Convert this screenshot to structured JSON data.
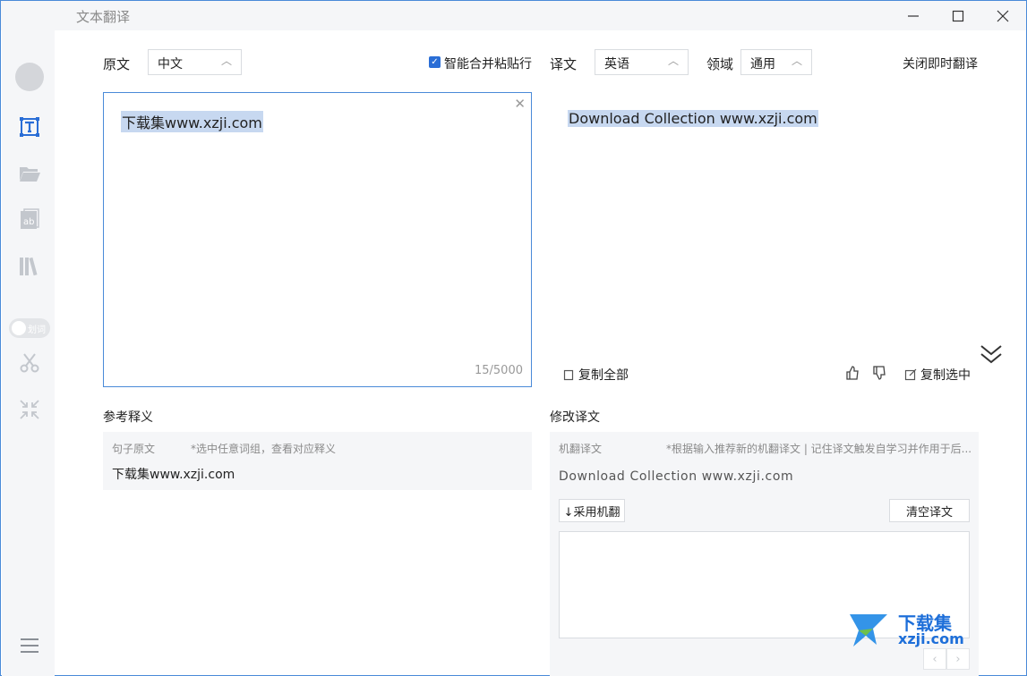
{
  "window": {
    "title": "文本翻译"
  },
  "source": {
    "label": "原文",
    "language": "中文",
    "smart_merge_label": "智能合并粘贴行",
    "text": "下载集www.xzji.com",
    "counter": "15/5000"
  },
  "target": {
    "label": "译文",
    "language": "英语",
    "domain_label": "领域",
    "domain": "通用",
    "close_instant": "关闭即时翻译",
    "text": "Download Collection www.xzji.com",
    "copy_all": "复制全部",
    "copy_selected": "复制选中"
  },
  "sidebar": {
    "toggle_text": "划词"
  },
  "reference": {
    "title": "参考释义",
    "sentence_label": "句子原文",
    "hint": "*选中任意词组，查看对应释义",
    "sentence": "下载集www.xzji.com"
  },
  "revise": {
    "title": "修改译文",
    "machine_label": "机翻译文",
    "machine_hint": "*根据输入推荐新的机翻译文 | 记住译文触发自学习并作用于后...",
    "machine_text": "Download Collection www.xzji.com",
    "adopt_button": "↓采用机翻",
    "clear_button": "清空译文"
  },
  "watermark": {
    "brand": "下载集",
    "site": "xzji.com"
  }
}
